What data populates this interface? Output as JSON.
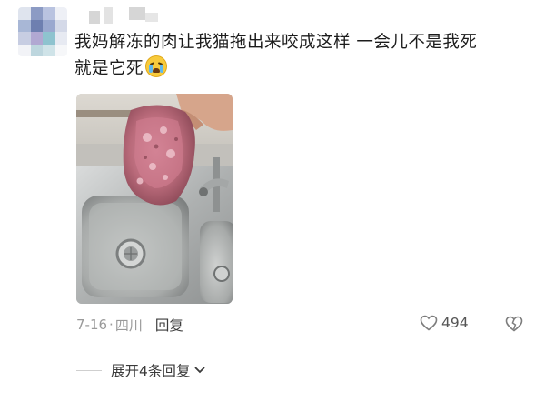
{
  "comment": {
    "text_line1": "我妈解冻的肉让我猫拖出来咬成这样 一会儿不是我死",
    "text_line2": "就是它死",
    "emoji": "loudly-crying-face",
    "date": "7-16",
    "separator": "·",
    "location": "四川",
    "reply_label": "回复",
    "like_count": "494",
    "expand_label": "展开4条回复"
  },
  "icons": {
    "like": "heart-outline-icon",
    "dislike": "broken-heart-icon",
    "expand": "chevron-down-icon"
  },
  "colors": {
    "text_primary": "#1c1c1c",
    "text_meta": "#9a9a9a",
    "accent_emoji": "#f8cb3c",
    "avatar_tones": [
      "#8fa3c7",
      "#b7c0d8",
      "#d9d3e6",
      "#a9c8d6"
    ]
  }
}
